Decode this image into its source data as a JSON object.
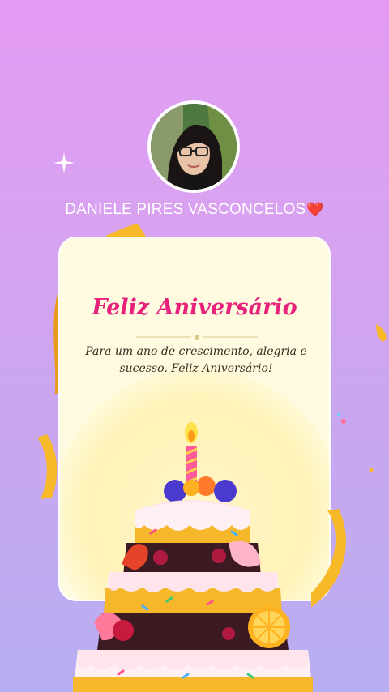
{
  "profile": {
    "name": "DANIELE PIRES VASCONCELOS",
    "heart": "❤️"
  },
  "card": {
    "title": "Feliz Aniversário",
    "message": "Para um ano de crescimento, alegria e sucesso. Feliz Aniversário!"
  },
  "colors": {
    "title": "#e8217a",
    "card_bg": "#fffbe0",
    "ribbon": "#f7b928",
    "text": "#ffffff"
  },
  "icons": [
    "sparkle-icon",
    "heart-icon",
    "birthday-cake-illustration",
    "ribbon-decoration"
  ]
}
